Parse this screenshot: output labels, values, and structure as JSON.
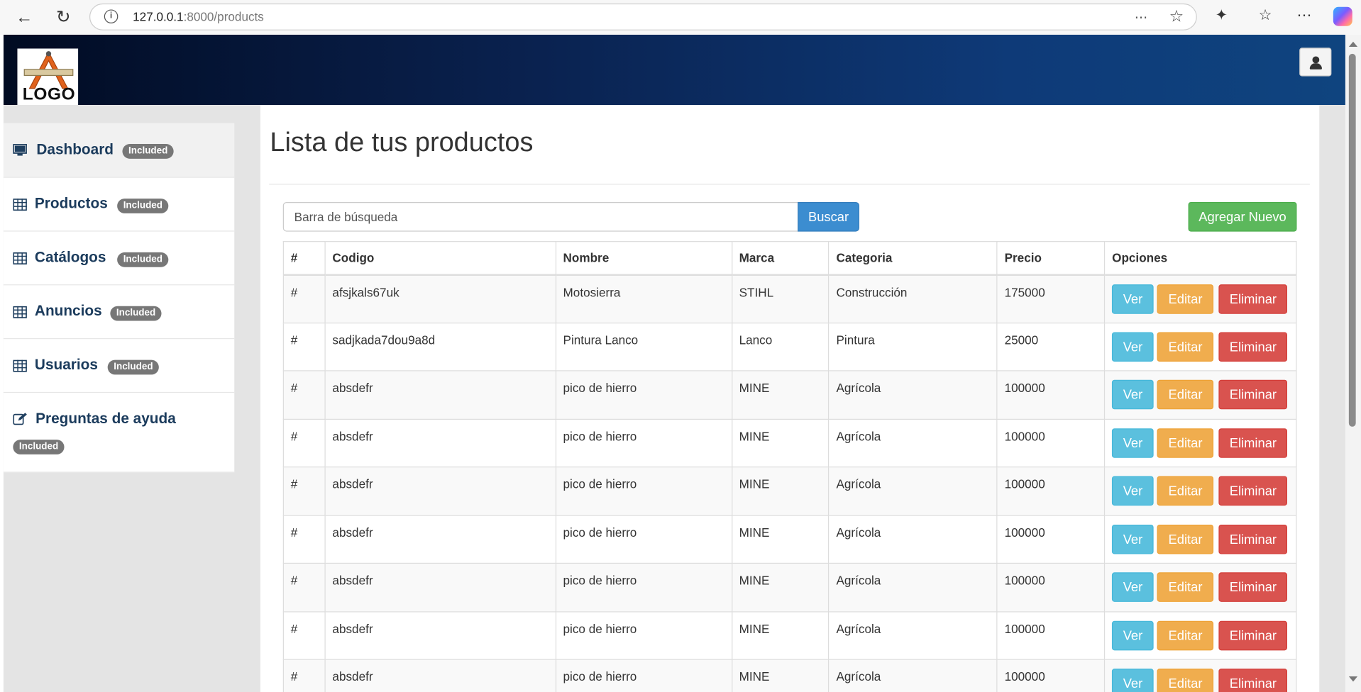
{
  "browser": {
    "url_host": "127.0.0.1",
    "url_rest": ":8000/products"
  },
  "header": {
    "logo_text": "LOGO"
  },
  "sidebar": {
    "items": [
      {
        "label": "Dashboard",
        "badge": "Included",
        "icon": "monitor-icon"
      },
      {
        "label": "Productos",
        "badge": "Included",
        "icon": "table-icon"
      },
      {
        "label": "Catálogos",
        "badge": "Included",
        "icon": "table-icon"
      },
      {
        "label": "Anuncios",
        "badge": "Included",
        "icon": "table-icon"
      },
      {
        "label": "Usuarios",
        "badge": "Included",
        "icon": "table-icon"
      },
      {
        "label": "Preguntas de ayuda",
        "badge": "Included",
        "icon": "edit-icon"
      }
    ]
  },
  "main": {
    "title": "Lista de tus productos",
    "search_placeholder": "Barra de búsqueda",
    "search_button": "Buscar",
    "add_button": "Agregar Nuevo",
    "table": {
      "headers": [
        "#",
        "Codigo",
        "Nombre",
        "Marca",
        "Categoria",
        "Precio",
        "Opciones"
      ],
      "rows": [
        {
          "num": "#",
          "codigo": "afsjkals67uk",
          "nombre": "Motosierra",
          "marca": "STIHL",
          "categoria": "Construcción",
          "precio": "175000"
        },
        {
          "num": "#",
          "codigo": "sadjkada7dou9a8d",
          "nombre": "Pintura Lanco",
          "marca": "Lanco",
          "categoria": "Pintura",
          "precio": "25000"
        },
        {
          "num": "#",
          "codigo": "absdefr",
          "nombre": "pico de hierro",
          "marca": "MINE",
          "categoria": "Agrícola",
          "precio": "100000"
        },
        {
          "num": "#",
          "codigo": "absdefr",
          "nombre": "pico de hierro",
          "marca": "MINE",
          "categoria": "Agrícola",
          "precio": "100000"
        },
        {
          "num": "#",
          "codigo": "absdefr",
          "nombre": "pico de hierro",
          "marca": "MINE",
          "categoria": "Agrícola",
          "precio": "100000"
        },
        {
          "num": "#",
          "codigo": "absdefr",
          "nombre": "pico de hierro",
          "marca": "MINE",
          "categoria": "Agrícola",
          "precio": "100000"
        },
        {
          "num": "#",
          "codigo": "absdefr",
          "nombre": "pico de hierro",
          "marca": "MINE",
          "categoria": "Agrícola",
          "precio": "100000"
        },
        {
          "num": "#",
          "codigo": "absdefr",
          "nombre": "pico de hierro",
          "marca": "MINE",
          "categoria": "Agrícola",
          "precio": "100000"
        },
        {
          "num": "#",
          "codigo": "absdefr",
          "nombre": "pico de hierro",
          "marca": "MINE",
          "categoria": "Agrícola",
          "precio": "100000"
        }
      ],
      "actions": {
        "view": "Ver",
        "edit": "Editar",
        "delete": "Eliminar"
      }
    }
  },
  "colors": {
    "header_dark": "#010b22",
    "header_light": "#0f447f",
    "btn_info": "#5bc0de",
    "btn_warning": "#f0ad4e",
    "btn_danger": "#d9534f",
    "btn_success": "#5cb85c",
    "btn_primary": "#3c8dd0"
  }
}
